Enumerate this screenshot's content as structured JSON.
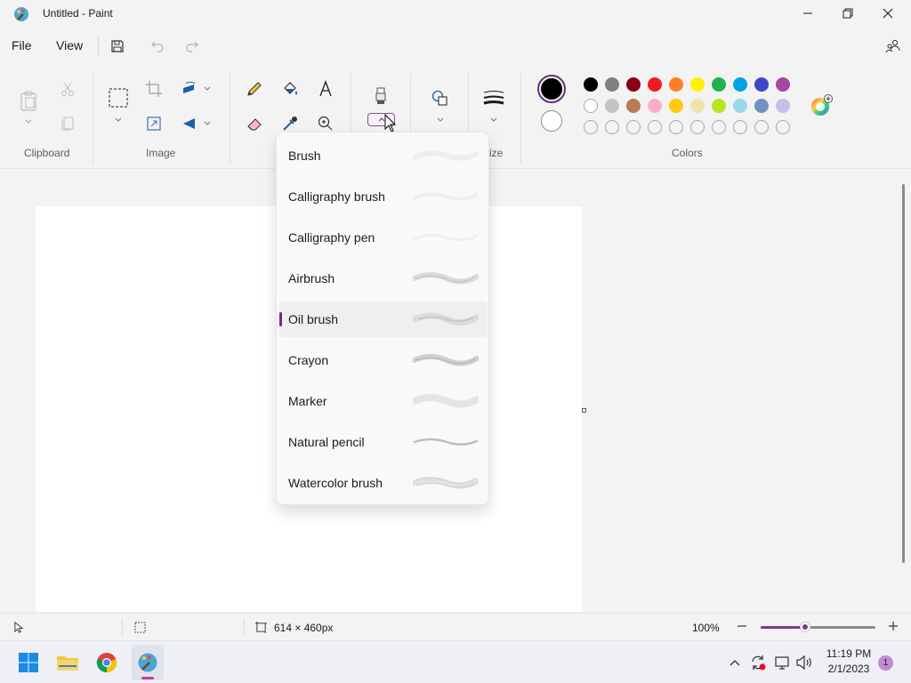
{
  "window": {
    "title": "Untitled - Paint"
  },
  "menu": {
    "file": "File",
    "view": "View"
  },
  "ribbon": {
    "groups": {
      "clipboard": "Clipboard",
      "image": "Image",
      "size_partial": "ize",
      "colors": "Colors"
    }
  },
  "colors": {
    "primary": "#000000",
    "secondary": "#ffffff",
    "row1": [
      "#000000",
      "#7f7f7f",
      "#880015",
      "#ed1c24",
      "#ff7f27",
      "#fff200",
      "#22b14c",
      "#00a2e8",
      "#3f48cc",
      "#a349a4"
    ],
    "row2": [
      "#ffffff",
      "#c3c3c3",
      "#b97a57",
      "#ffaec9",
      "#ffc90e",
      "#efe4b0",
      "#b5e61d",
      "#99d9ea",
      "#7092be",
      "#c8bfe7"
    ],
    "row3_empty_count": 10
  },
  "brush_menu": {
    "items": [
      {
        "label": "Brush"
      },
      {
        "label": "Calligraphy brush"
      },
      {
        "label": "Calligraphy pen"
      },
      {
        "label": "Airbrush"
      },
      {
        "label": "Oil brush"
      },
      {
        "label": "Crayon"
      },
      {
        "label": "Marker"
      },
      {
        "label": "Natural pencil"
      },
      {
        "label": "Watercolor brush"
      }
    ],
    "selected": "Oil brush"
  },
  "status": {
    "canvas_size": "614 × 460px",
    "zoom": "100%",
    "zoom_level_fraction": 0.5
  },
  "taskbar": {
    "time": "11:19 PM",
    "date": "2/1/2023",
    "notification_count": "1"
  }
}
